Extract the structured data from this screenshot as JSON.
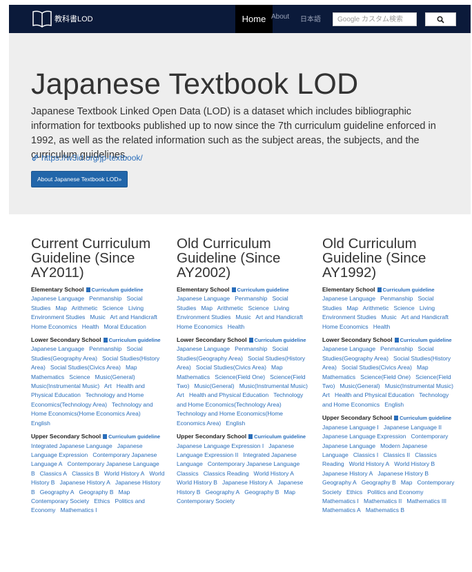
{
  "nav": {
    "brand": "教科書LOD",
    "home": "Home",
    "about": "About",
    "japanese": "日本語",
    "search_placeholder": "Google カスタム検索"
  },
  "hero": {
    "title": "Japanese Textbook LOD",
    "description": "Japanese Textbook Linked Open Data (LOD) is a dataset which includes bibliographic information for textbooks published up to now since the 7th curriculum guideline enforced in 1992, as well as the related information such as the subject areas, the subjects, and the curriculum guidelines.",
    "link": "https://w3id.org/jp-textbook/",
    "button": "About Japanese Textbook LOD»"
  },
  "columns": [
    {
      "title": "Current Curriculum Guideline (Since AY2011)",
      "sections": [
        {
          "name": "Elementary School",
          "guide": "Curriculum guideline",
          "subjects": [
            "Japanese Language",
            "Penmanship",
            "Social Studies",
            "Map",
            "Arithmetic",
            "Science",
            "Living Environment Studies",
            "Music",
            "Art and Handicraft",
            "Home Economics",
            "Health",
            "Moral Education"
          ]
        },
        {
          "name": "Lower Secondary School",
          "guide": "Curriculum guideline",
          "subjects": [
            "Japanese Language",
            "Penmanship",
            "Social Studies(Geography Area)",
            "Social Studies(History Area)",
            "Social Studies(Civics Area)",
            "Map",
            "Mathematics",
            "Science",
            "Music(General)",
            "Music(Instrumental Music)",
            "Art",
            "Health and Physical Education",
            "Technology and Home Economics(Technology Area)",
            "Technology and Home Economics(Home Economics Area)",
            "English"
          ]
        },
        {
          "name": "Upper Secondary School",
          "guide": "Curriculum guideline",
          "subjects": [
            "Integrated Japanese Language",
            "Japanese Language Expression",
            "Contemporary Japanese Language A",
            "Contemporary Japanese Language B",
            "Classics A",
            "Classics B",
            "World History A",
            "World History B",
            "Japanese History A",
            "Japanese History B",
            "Geography A",
            "Geography B",
            "Map",
            "Contemporary Society",
            "Ethics",
            "Politics and Economy",
            "Mathematics I"
          ]
        }
      ]
    },
    {
      "title": "Old Curriculum Guideline (Since AY2002)",
      "sections": [
        {
          "name": "Elementary School",
          "guide": "Curriculum guideline",
          "subjects": [
            "Japanese Language",
            "Penmanship",
            "Social Studies",
            "Map",
            "Arithmetic",
            "Science",
            "Living Environment Studies",
            "Music",
            "Art and Handicraft",
            "Home Economics",
            "Health"
          ]
        },
        {
          "name": "Lower Secondary School",
          "guide": "Curriculum guideline",
          "subjects": [
            "Japanese Language",
            "Penmanship",
            "Social Studies(Geography Area)",
            "Social Studies(History Area)",
            "Social Studies(Civics Area)",
            "Map",
            "Mathematics",
            "Science(Field One)",
            "Science(Field Two)",
            "Music(General)",
            "Music(Instrumental Music)",
            "Art",
            "Health and Physical Education",
            "Technology and Home Economics(Technology Area)",
            "Technology and Home Economics(Home Economics Area)",
            "English"
          ]
        },
        {
          "name": "Upper Secondary School",
          "guide": "Curriculum guideline",
          "subjects": [
            "Japanese Language Expression I",
            "Japanese Language Expression II",
            "Integrated Japanese Language",
            "Contemporary Japanese Language",
            "Classics",
            "Classics Reading",
            "World History A",
            "World History B",
            "Japanese History A",
            "Japanese History B",
            "Geography A",
            "Geography B",
            "Map",
            "Contemporary Society"
          ]
        }
      ]
    },
    {
      "title": "Old Curriculum Guideline (Since AY1992)",
      "sections": [
        {
          "name": "Elementary School",
          "guide": "Curriculum guideline",
          "subjects": [
            "Japanese Language",
            "Penmanship",
            "Social Studies",
            "Map",
            "Arithmetic",
            "Science",
            "Living Environment Studies",
            "Music",
            "Art and Handicraft",
            "Home Economics",
            "Health"
          ]
        },
        {
          "name": "Lower Secondary School",
          "guide": "Curriculum guideline",
          "subjects": [
            "Japanese Language",
            "Penmanship",
            "Social Studies(Geography Area)",
            "Social Studies(History Area)",
            "Social Studies(Civics Area)",
            "Map",
            "Mathematics",
            "Science(Field One)",
            "Science(Field Two)",
            "Music(General)",
            "Music(Instrumental Music)",
            "Art",
            "Health and Physical Education",
            "Technology and Home Economics",
            "English"
          ]
        },
        {
          "name": "Upper Secondary School",
          "guide": "Curriculum guideline",
          "subjects": [
            "Japanese Language I",
            "Japanese Language II",
            "Japanese Language Expression",
            "Contemporary Japanese Language",
            "Modern Japanese Language",
            "Classics I",
            "Classics II",
            "Classics Reading",
            "World History A",
            "World History B",
            "Japanese History A",
            "Japanese History B",
            "Geography A",
            "Geography B",
            "Map",
            "Contemporary Society",
            "Ethics",
            "Politics and Economy",
            "Mathematics I",
            "Mathematics II",
            "Mathematics III",
            "Mathematics A",
            "Mathematics B"
          ]
        }
      ]
    }
  ]
}
